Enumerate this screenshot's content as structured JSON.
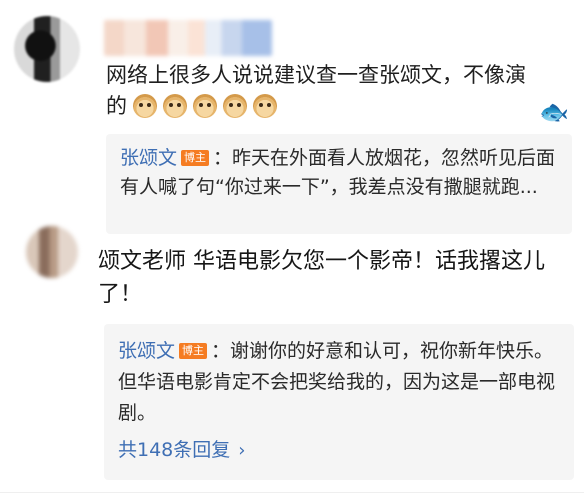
{
  "comments": [
    {
      "text": "网络上很多人说说建议查一查张颂文，不像演的",
      "emoji_count": 5,
      "reply": {
        "author": "张颂文",
        "badge": "博主",
        "text": "：昨天在外面看人放烟花，忽然听见后面有人喊了句“你过来一下”，我差点没有撒腿就跑..."
      }
    },
    {
      "text": "颂文老师 华语电影欠您一个影帝！话我撂这儿了！",
      "reply": {
        "author": "张颂文",
        "badge": "博主",
        "text": "：谢谢你的好意和认可，祝你新年快乐。但华语电影肯定不会把奖给我的，因为这是一部电视剧。",
        "more": "共148条回复",
        "more_icon": "chevron-right-icon"
      }
    }
  ],
  "icons": {
    "sticker": "fish-sticker-icon",
    "emoji": "doge-emoji-icon"
  }
}
